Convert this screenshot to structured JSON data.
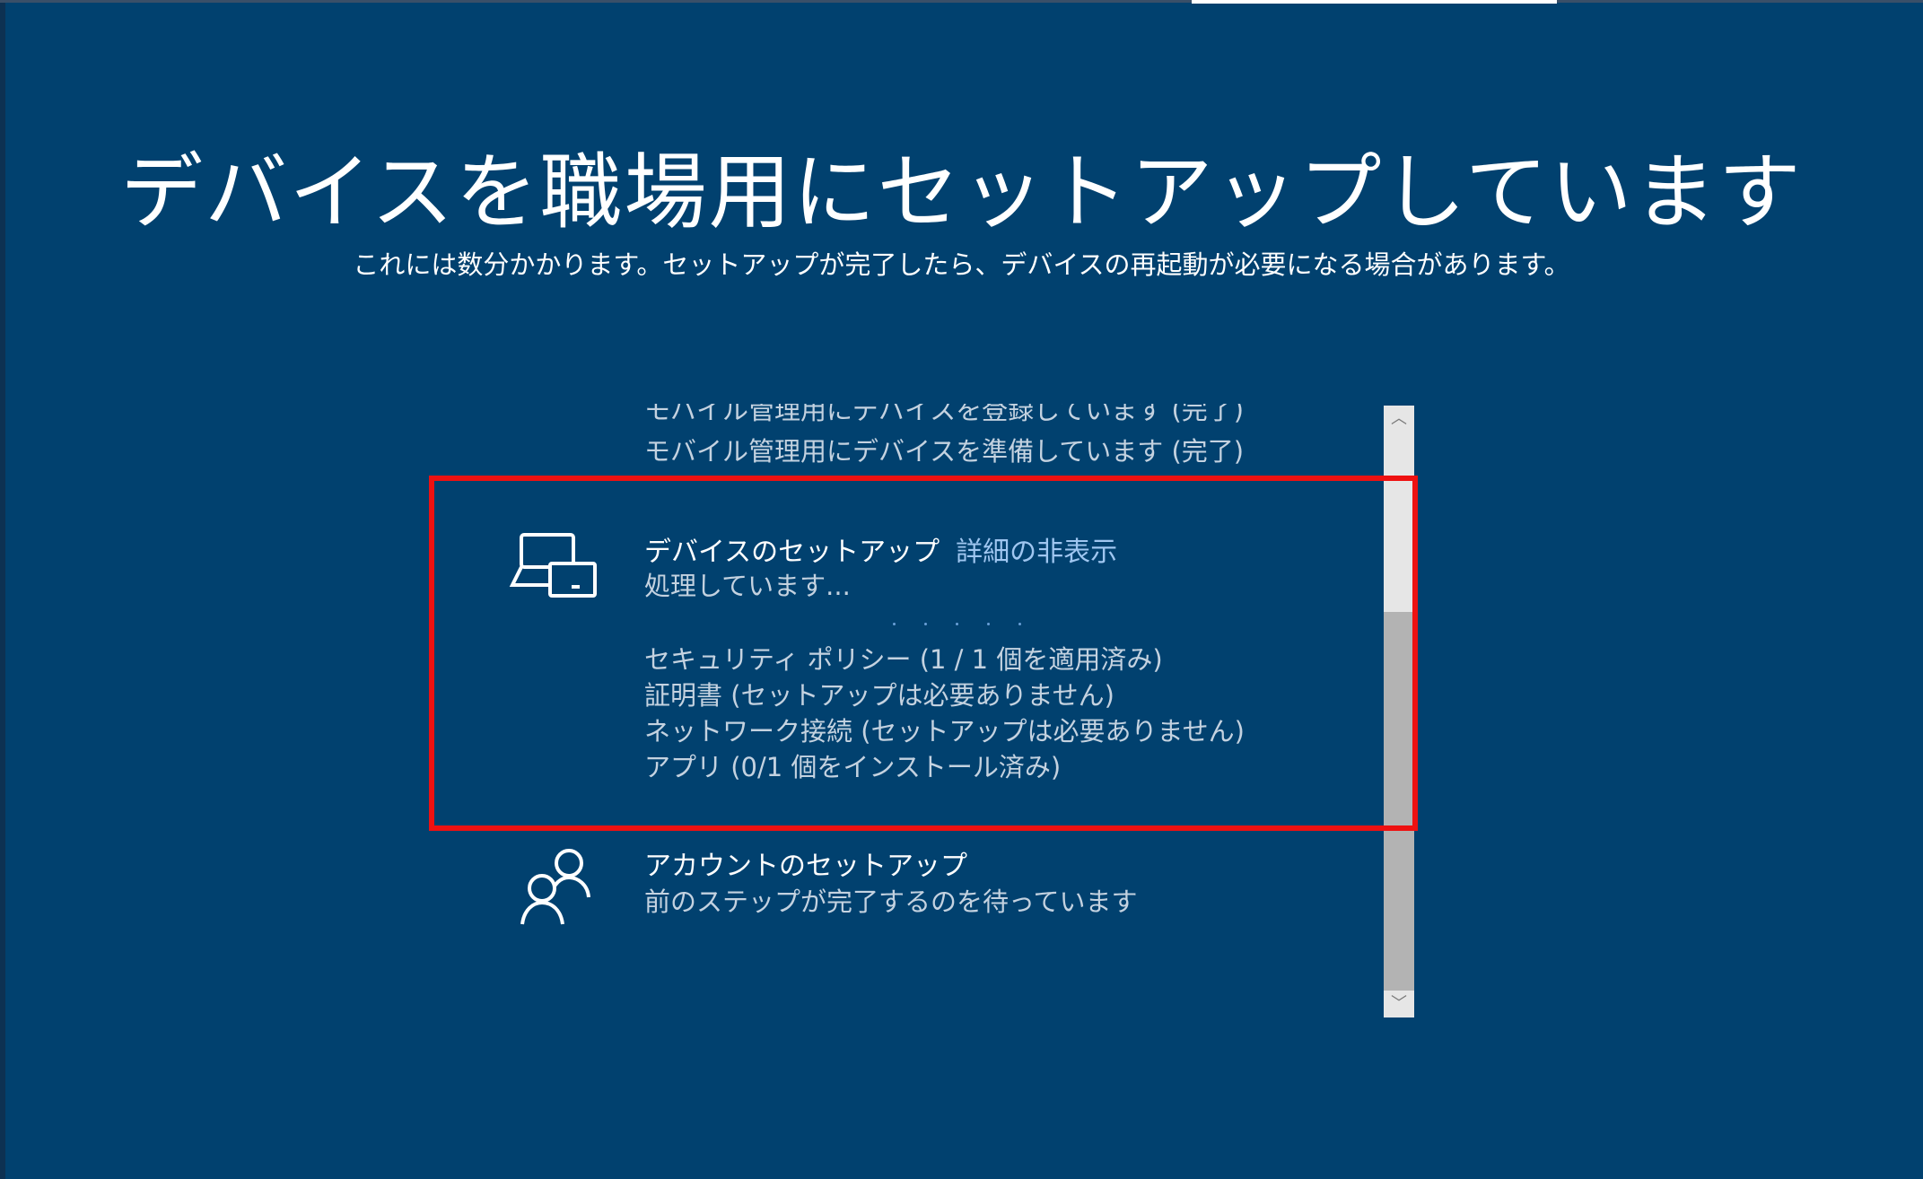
{
  "header": {
    "title": "デバイスを職場用にセットアップしています",
    "subtitle": "これには数分かかります。セットアップが完了したら、デバイスの再起動が必要になる場合があります。"
  },
  "completed_steps": [
    "モバイル管理用にデバイスを登録しています (完了)",
    "モバイル管理用にデバイスを準備しています (完了)"
  ],
  "device_setup": {
    "title": "デバイスのセットアップ",
    "details_link": "詳細の非表示",
    "status": "処理しています...",
    "icon": "device-icon",
    "details": [
      "セキュリティ ポリシー (1 / 1 個を適用済み)",
      "証明書 (セットアップは必要ありません)",
      "ネットワーク接続 (セットアップは必要ありません)",
      "アプリ (0/1 個をインストール済み)"
    ]
  },
  "account_setup": {
    "title": "アカウントのセットアップ",
    "status": "前のステップが完了するのを待っています",
    "icon": "people-icon"
  },
  "scrollbar": {
    "up_glyph": "︿",
    "down_glyph": "﹀"
  },
  "colors": {
    "background": "#01416f",
    "highlight": "#ee1111",
    "link": "#9fc6f0"
  }
}
